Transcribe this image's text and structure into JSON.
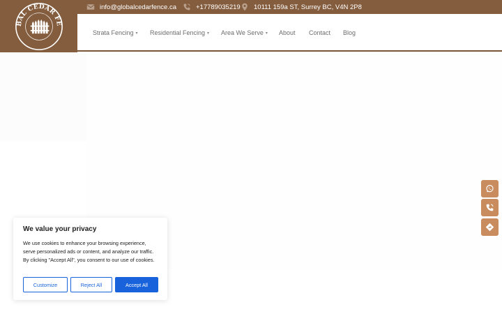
{
  "colors": {
    "brand_brown": "#845d3f",
    "side_button": "#c88c5e",
    "cookie_accent": "#1863dc"
  },
  "topbar": {
    "email": {
      "icon": "envelope-icon",
      "text": "info@globalcedarfence.ca"
    },
    "phone": {
      "icon": "phone-icon",
      "text": "+17789035219"
    },
    "address": {
      "icon": "map-pin-icon",
      "text": "10111 159a ST, Surrey BC, V4N 2P8"
    }
  },
  "logo": {
    "text": "GLOBAL CEDAR FENCE"
  },
  "nav": {
    "items": [
      {
        "label": "Strata Fencing",
        "caret": "▾"
      },
      {
        "label": "Residential Fencing",
        "caret": "▾"
      },
      {
        "label": "Area We Serve",
        "caret": "▾"
      },
      {
        "label": "About"
      },
      {
        "label": "Contact"
      },
      {
        "label": "Blog"
      }
    ]
  },
  "side_buttons": [
    {
      "icon": "whatsapp-icon"
    },
    {
      "icon": "phone-icon"
    },
    {
      "icon": "directions-icon"
    }
  ],
  "cookie": {
    "title": "We value your privacy",
    "text": "We use cookies to enhance your browsing experience, serve personalized ads or content, and analyze our traffic. By clicking \"Accept All\", you consent to our use of cookies.",
    "customize": "Customize",
    "reject": "Reject All",
    "accept": "Accept All"
  }
}
